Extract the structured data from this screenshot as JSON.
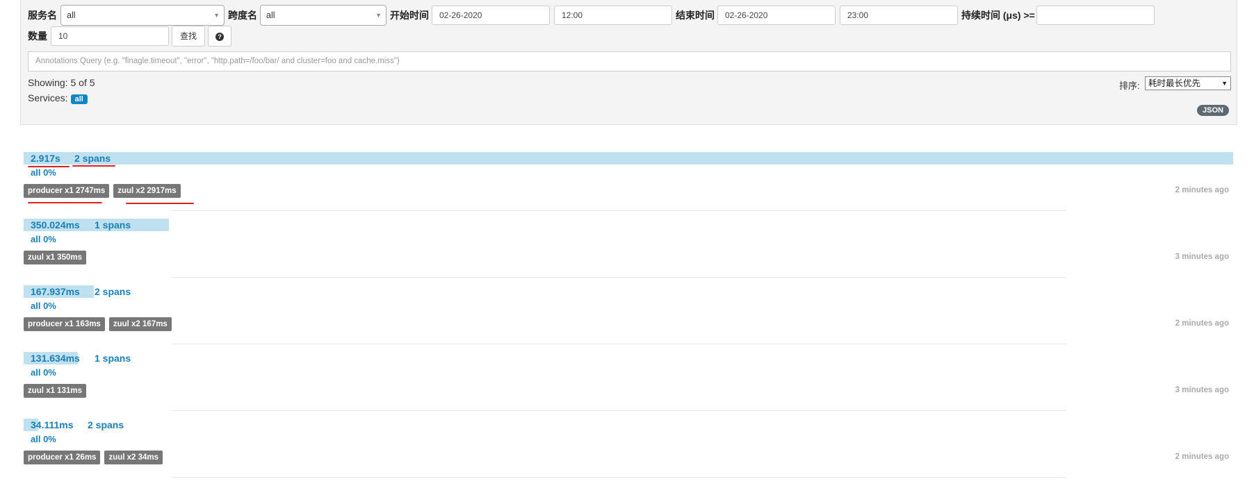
{
  "search": {
    "service_label": "服务名",
    "service_value": "all",
    "span_label": "跨度名",
    "span_value": "all",
    "start_label": "开始时间",
    "start_date": "02-26-2020",
    "start_time": "12:00",
    "end_label": "结束时间",
    "end_date": "02-26-2020",
    "end_time": "23:00",
    "duration_label": "持续时间 (μs) >=",
    "duration_value": "",
    "limit_label": "数量",
    "limit_value": "10",
    "find_button": "查找",
    "help_icon": "?",
    "annotation_placeholder": "Annotations Query (e.g. \"finagle.timeout\", \"error\", \"http.path=/foo/bar/ and cluster=foo and cache.miss\")"
  },
  "results": {
    "showing": "Showing: 5 of 5",
    "services_label": "Services:",
    "services_badge": "all",
    "sort_label": "排序:",
    "sort_value": "耗时最长优先",
    "json_button": "JSON"
  },
  "colors": {
    "accent": "#1a7fb3",
    "bar": "#bfe0ef",
    "tag": "#777777",
    "annotation_red": "#e02020"
  },
  "traces": [
    {
      "duration": "2.917s",
      "spans": "2 spans",
      "percent": "all 0%",
      "bar_fraction": 1.0,
      "tags": [
        "producer x1 2747ms",
        "zuul x2 2917ms"
      ],
      "ago": "2 minutes ago"
    },
    {
      "duration": "350.024ms",
      "spans": "1 spans",
      "percent": "all 0%",
      "bar_fraction": 0.12,
      "tags": [
        "zuul x1 350ms"
      ],
      "ago": "3 minutes ago"
    },
    {
      "duration": "167.937ms",
      "spans": "2 spans",
      "percent": "all 0%",
      "bar_fraction": 0.058,
      "tags": [
        "producer x1 163ms",
        "zuul x2 167ms"
      ],
      "ago": "2 minutes ago"
    },
    {
      "duration": "131.634ms",
      "spans": "1 spans",
      "percent": "all 0%",
      "bar_fraction": 0.045,
      "tags": [
        "zuul x1 131ms"
      ],
      "ago": "3 minutes ago"
    },
    {
      "duration": "34.111ms",
      "spans": "2 spans",
      "percent": "all 0%",
      "bar_fraction": 0.012,
      "tags": [
        "producer x1 26ms",
        "zuul x2 34ms"
      ],
      "ago": "2 minutes ago"
    }
  ]
}
